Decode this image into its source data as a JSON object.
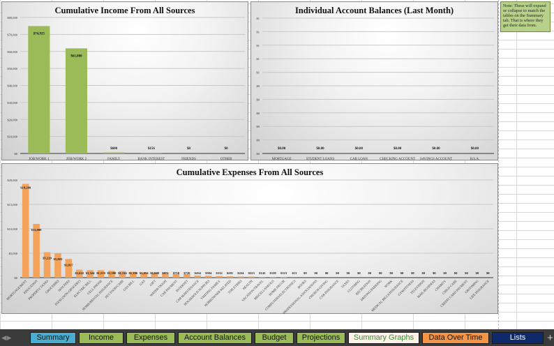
{
  "note": "Note: These will expand or collapse to match the tables on the Summary tab. That is where they get their data from.",
  "tabs": [
    {
      "label": "Summary",
      "color": "#4aaed0",
      "text": "#111"
    },
    {
      "label": "Income",
      "color": "#9bbb59",
      "text": "#111"
    },
    {
      "label": "Expenses",
      "color": "#9bbb59",
      "text": "#111"
    },
    {
      "label": "Account Balances",
      "color": "#9bbb59",
      "text": "#111"
    },
    {
      "label": "Budget",
      "color": "#9bbb59",
      "text": "#111"
    },
    {
      "label": "Projections",
      "color": "#9bbb59",
      "text": "#111"
    },
    {
      "label": "Summary Graphs",
      "color": "#fdf1ea",
      "text": "#3f8a3a",
      "active": true
    },
    {
      "label": "Data Over Time",
      "color": "#f39545",
      "text": "#111"
    },
    {
      "label": "Lists",
      "color": "#0f2a6a",
      "text": "#fff"
    }
  ],
  "add_tab": "+",
  "chart_data": [
    {
      "type": "bar",
      "title": "Cumulative Income From All Sources",
      "bar_color": "#9bbb59",
      "categories": [
        "JOB/WORK 1",
        "JOB/WORK 2",
        "FAMILY",
        "BANK INTEREST",
        "FRIENDS",
        "OTHER"
      ],
      "values": [
        74925,
        61800,
        600,
        156,
        0,
        0
      ],
      "labels": [
        "$74,925",
        "$61,800",
        "$600",
        "$156",
        "$0",
        "$0"
      ],
      "ylim": [
        0,
        80000
      ],
      "yticks": [
        "$0",
        "$10,000",
        "$20,000",
        "$30,000",
        "$40,000",
        "$50,000",
        "$60,000",
        "$70,000",
        "$80,000"
      ],
      "grid": true,
      "label_rotate": false
    },
    {
      "type": "bar",
      "title": "Individual Account Balances (Last Month)",
      "bar_color": "#4f81bd",
      "categories": [
        "MORTGAGE",
        "STUDENT LOANS",
        "CAR LOAN",
        "CHECKING ACCOUNT",
        "SAVINGS ACCOUNT",
        "H.S.A."
      ],
      "values": [
        0,
        0,
        0,
        0,
        0,
        0
      ],
      "labels": [
        "$0.00",
        "$0.00",
        "$0.00",
        "$0.00",
        "$0.00",
        "$0.00"
      ],
      "ylim": [
        0,
        1
      ],
      "yticks": [
        "$0",
        "$0",
        "$0",
        "$0",
        "$0",
        "$0",
        "$1",
        "$1",
        "$1",
        "$1",
        "$1"
      ],
      "grid": true,
      "label_rotate": false
    },
    {
      "type": "bar",
      "title": "Cumulative Expenses From All Sources",
      "bar_color": "#f5a35a",
      "categories": [
        "MORTGAGE/RENT",
        "EDUCATION",
        "PROPERTY TAXES",
        "GROCERIES",
        "HOA FEES",
        "FOOD (NON-GROCERY)",
        "ELECTRIC BILL",
        "CELL PHONE",
        "HOME/RENTAL INSURANCE",
        "PET FOOD/CARE",
        "GAS BILL",
        "GAS",
        "GIFT",
        "WATER/TRASH",
        "CAR PAYMENT",
        "INTERNET",
        "CAR MAINTENANCE",
        "HOUSEHOLD SUPPLIES",
        "VISITING FAMILY",
        "HOMEOWNER RELATED",
        "TOILETRIES",
        "HEALTH",
        "VACATION/TRAVEL",
        "MISCELLANEOUS",
        "HOME DECOR",
        "COMPUTERS/ELECTRONICS",
        "BOOKS",
        "PROFESSIONAL ASSOCIATIONS",
        "CHURCH GIVING",
        "CAR INSURANCE",
        "TAXES",
        "CLOTHING",
        "RECREATION",
        "DRIVING/PARKING",
        "WORK",
        "MEDICAL BILLS/INSURANCE",
        "GYM/FITNESS",
        "TELEVISION",
        "MAIL/BUSINESS",
        "CHARITY",
        "CHILD CARE",
        "CREDIT CARD PAYMENT",
        "GROOMING",
        "LIFE INSURANCE"
      ],
      "values": [
        19200,
        11000,
        5220,
        5003,
        3817,
        1622,
        1524,
        1519,
        1390,
        1314,
        1186,
        1054,
        1048,
        971,
        750,
        720,
        434,
        384,
        312,
        281,
        224,
        223,
        143,
        129,
        123,
        13,
        9,
        0,
        0,
        0,
        0,
        0,
        0,
        0,
        0,
        0,
        0,
        0,
        0,
        0,
        0,
        0,
        0,
        0
      ],
      "labels": [
        "$19,200",
        "$11,000",
        "$5,220",
        "$5,003",
        "$3,817",
        "$1,622",
        "$1,524",
        "$1,519",
        "$1,390",
        "$1,314",
        "$1,186",
        "$1,054",
        "$1,048",
        "$971",
        "$750",
        "$720",
        "$434",
        "$384",
        "$312",
        "$281",
        "$224",
        "$223",
        "$143",
        "$129",
        "$123",
        "$13",
        "$9",
        "$0",
        "$0",
        "$0",
        "$0",
        "$0",
        "$0",
        "$0",
        "$0",
        "$0",
        "$0",
        "$0",
        "$0",
        "$0",
        "$0",
        "$0",
        "$0",
        "$0"
      ],
      "ylim": [
        0,
        20000
      ],
      "yticks": [
        "$0",
        "$5,000",
        "$10,000",
        "$15,000",
        "$20,000"
      ],
      "grid": true,
      "label_rotate": true
    }
  ]
}
